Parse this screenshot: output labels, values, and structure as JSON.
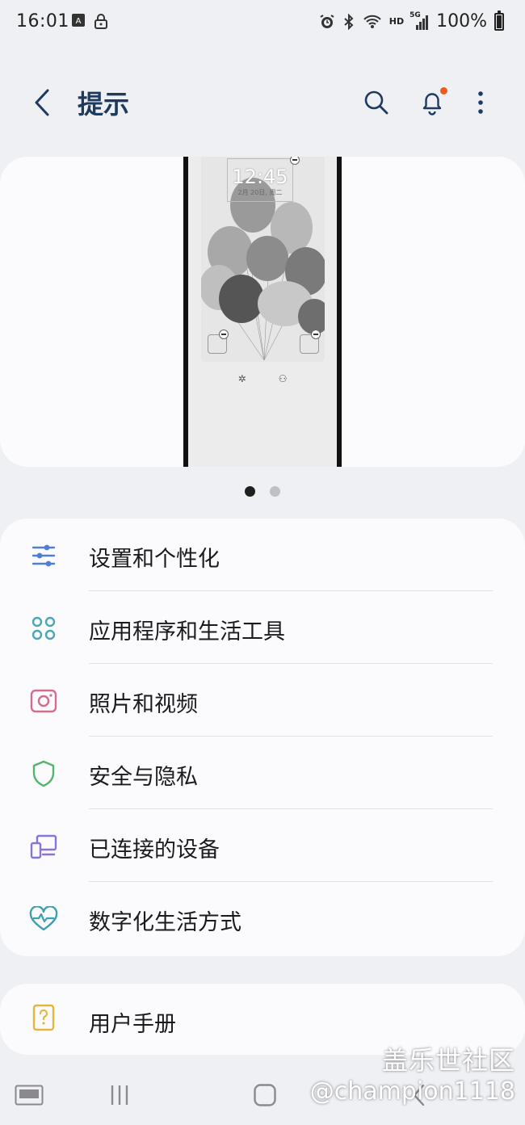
{
  "status_bar": {
    "time": "16:01",
    "network": "HD",
    "signal": "5G",
    "battery": "100%"
  },
  "header": {
    "title": "提示"
  },
  "carousel": {
    "lock_time": "12:45",
    "lock_date": "2月 20日, 周二",
    "page_count": 2,
    "active_page": 1
  },
  "menu": {
    "items": [
      {
        "label": "设置和个性化",
        "icon": "sliders-icon",
        "color": "#4f7fd4"
      },
      {
        "label": "应用程序和生活工具",
        "icon": "apps-grid-icon",
        "color": "#4aa7b3"
      },
      {
        "label": "照片和视频",
        "icon": "camera-icon",
        "color": "#d36d8c"
      },
      {
        "label": "安全与隐私",
        "icon": "shield-icon",
        "color": "#52b56d"
      },
      {
        "label": "已连接的设备",
        "icon": "connected-devices-icon",
        "color": "#8a73d6"
      },
      {
        "label": "数字化生活方式",
        "icon": "heartbeat-icon",
        "color": "#3f9fb0"
      }
    ]
  },
  "manual": {
    "label": "用户手册",
    "icon": "question-book-icon",
    "color": "#e2b73a"
  },
  "watermark": {
    "line1": "盖乐世社区",
    "line2": "@champion1118"
  }
}
